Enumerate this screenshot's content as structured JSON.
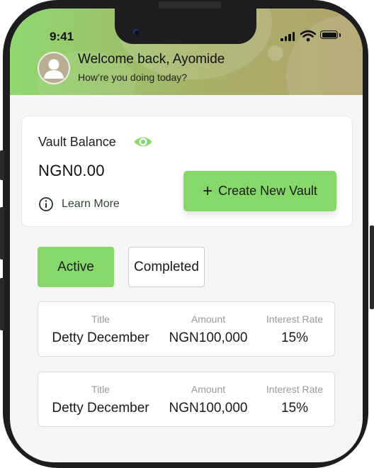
{
  "status_bar": {
    "time": "9:41"
  },
  "header": {
    "greeting": "Welcome back, Ayomide",
    "subtitle": "How’re you doing today?"
  },
  "balance_card": {
    "label": "Vault Balance",
    "amount": "NGN0.00",
    "learn_more": "Learn More",
    "create_button": "Create New Vault"
  },
  "tabs": [
    {
      "label": "Active",
      "selected": true
    },
    {
      "label": "Completed",
      "selected": false
    }
  ],
  "vault_table": {
    "headers": {
      "title": "Title",
      "amount": "Amount",
      "rate": "Interest Rate"
    },
    "rows": [
      {
        "title": "Detty December",
        "amount": "NGN100,000",
        "rate": "15%"
      },
      {
        "title": "Detty December",
        "amount": "NGN100,000",
        "rate": "15%"
      }
    ]
  },
  "colors": {
    "accent": "#86d86a",
    "header_gradient_start": "#8fd870",
    "header_gradient_end": "#b1a36d",
    "frame": "#1d1d1f"
  },
  "icons": [
    "avatar-icon",
    "eye-icon",
    "info-icon",
    "plus-icon",
    "signal-icon",
    "wifi-icon",
    "battery-icon"
  ]
}
